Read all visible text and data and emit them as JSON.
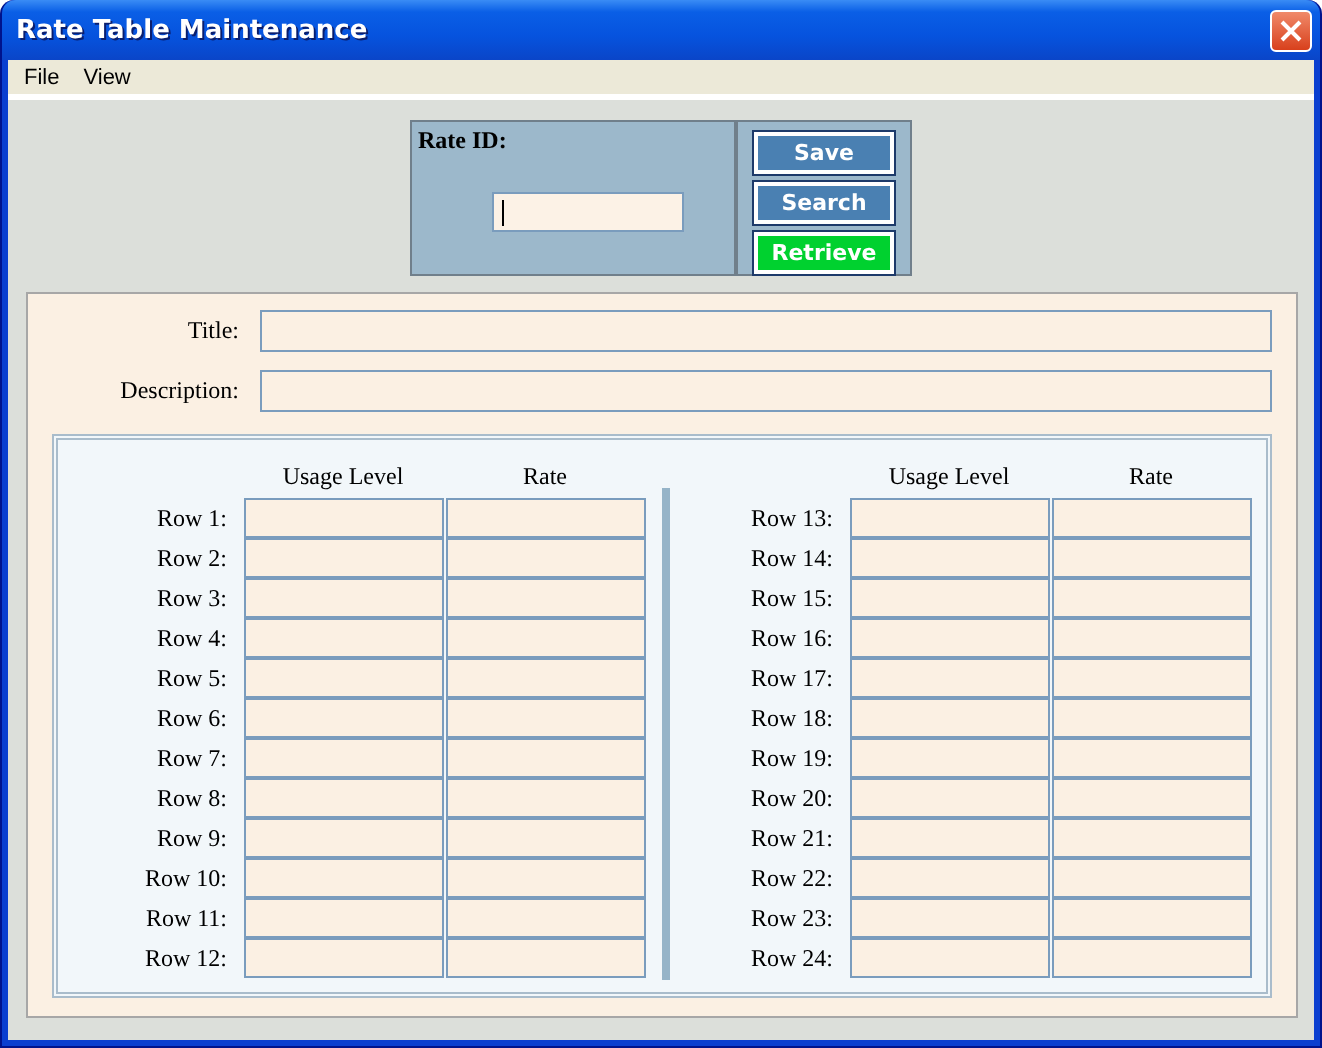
{
  "window": {
    "title": "Rate Table Maintenance"
  },
  "menu": [
    "File",
    "View"
  ],
  "rate_id": {
    "label": "Rate ID:",
    "focused": true
  },
  "buttons": [
    {
      "label": "Save",
      "kind": "normal"
    },
    {
      "label": "Search",
      "kind": "normal"
    },
    {
      "label": "Retrieve",
      "kind": "primary"
    }
  ],
  "fields": [
    {
      "label": "Title:"
    },
    {
      "label": "Description:"
    }
  ],
  "table": {
    "columns": [
      "Usage Level",
      "Rate"
    ],
    "left_rows": [
      "Row 1:",
      "Row 2:",
      "Row 3:",
      "Row 4:",
      "Row 5:",
      "Row 6:",
      "Row 7:",
      "Row 8:",
      "Row 9:",
      "Row 10:",
      "Row 11:",
      "Row 12:"
    ],
    "right_columns": [
      "Usage Level",
      "Rate"
    ],
    "right_rows": [
      "Row 13:",
      "Row 14:",
      "Row 15:",
      "Row 16:",
      "Row 17:",
      "Row 18:",
      "Row 19:",
      "Row 20:",
      "Row 21:",
      "Row 22:",
      "Row 23:",
      "Row 24:"
    ]
  }
}
